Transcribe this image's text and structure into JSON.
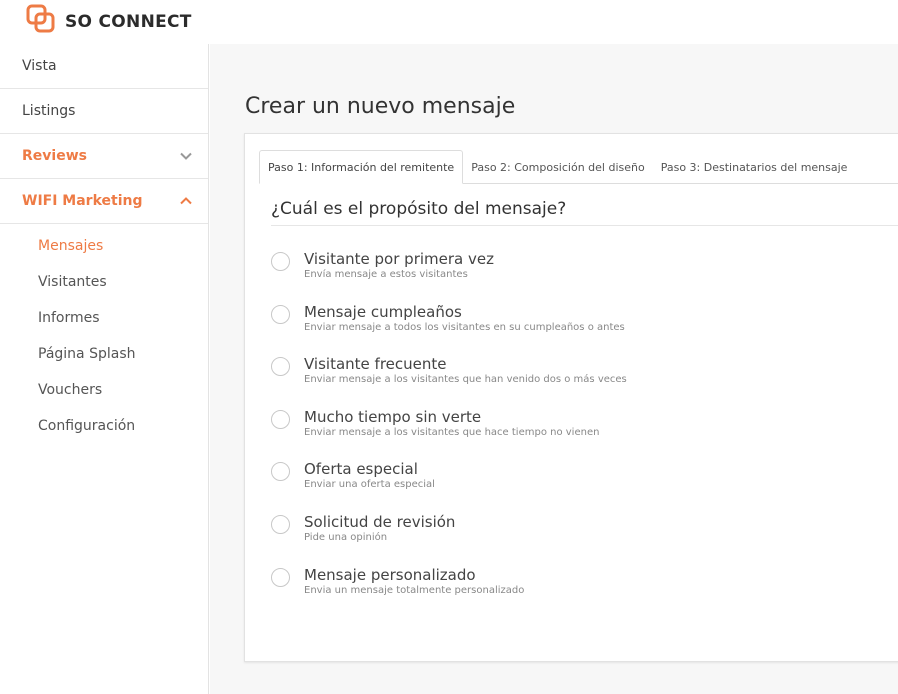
{
  "brand": {
    "name": "SO CONNECT",
    "accent": "#ee7b45"
  },
  "sidebar": {
    "items": [
      {
        "label": "Vista"
      },
      {
        "label": "Listings"
      },
      {
        "label": "Reviews",
        "icon": "chevron-down-icon"
      },
      {
        "label": "WIFI Marketing",
        "icon": "chevron-up-icon"
      }
    ],
    "subitems": [
      {
        "label": "Mensajes",
        "active": true
      },
      {
        "label": "Visitantes"
      },
      {
        "label": "Informes"
      },
      {
        "label": "Página Splash"
      },
      {
        "label": "Vouchers"
      },
      {
        "label": "Configuración"
      }
    ]
  },
  "main": {
    "title": "Crear un nuevo mensaje",
    "tabs": [
      {
        "label": "Paso 1: Información del remitente",
        "active": true
      },
      {
        "label": "Paso 2: Composición del diseño"
      },
      {
        "label": "Paso 3: Destinatarios del mensaje"
      }
    ],
    "question": "¿Cuál es el propósito del mensaje?",
    "options": [
      {
        "label": "Visitante por primera vez",
        "desc": "Envía mensaje a estos visitantes"
      },
      {
        "label": "Mensaje cumpleaños",
        "desc": "Enviar mensaje a todos los visitantes en su cumpleaños o antes"
      },
      {
        "label": "Visitante frecuente",
        "desc": "Enviar mensaje a los visitantes que han venido dos o más veces"
      },
      {
        "label": "Mucho tiempo sin verte",
        "desc": "Enviar mensaje a los visitantes que hace tiempo no vienen"
      },
      {
        "label": "Oferta especial",
        "desc": "Enviar una oferta especial"
      },
      {
        "label": "Solicitud de revisión",
        "desc": "Pide una opinión"
      },
      {
        "label": "Mensaje personalizado",
        "desc": "Envia un mensaje totalmente personalizado"
      }
    ]
  }
}
